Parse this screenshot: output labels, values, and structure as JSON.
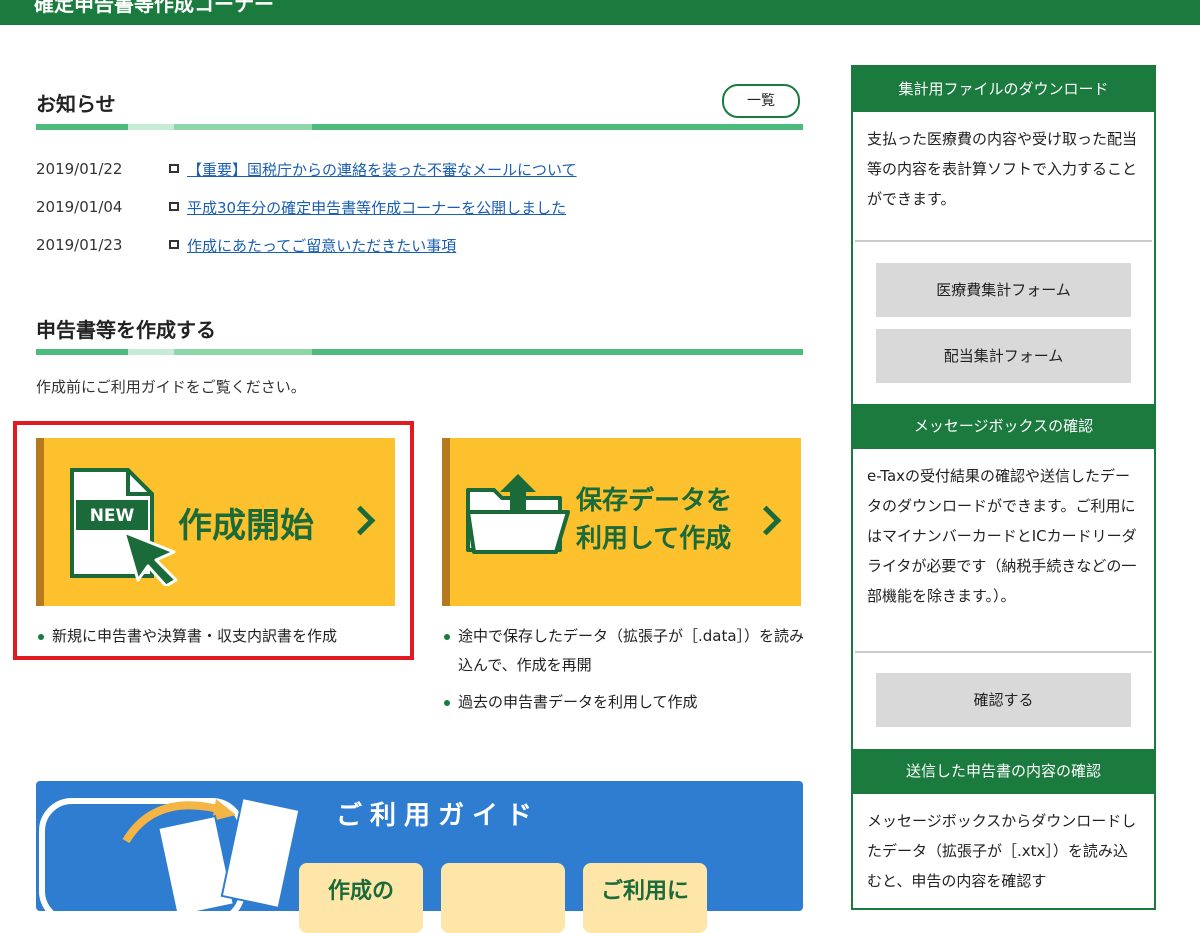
{
  "header": {
    "title": "確定申告書等作成コーナー"
  },
  "news": {
    "title": "お知らせ",
    "list_button": "一覧",
    "items": [
      {
        "date": "2019/01/22",
        "text": "【重要】国税庁からの連絡を装った不審なメールについて"
      },
      {
        "date": "2019/01/04",
        "text": "平成30年分の確定申告書等作成コーナーを公開しました"
      },
      {
        "date": "2019/01/23",
        "text": "作成にあたってご留意いただきたい事項"
      }
    ]
  },
  "create": {
    "title": "申告書等を作成する",
    "intro": "作成前にご利用ガイドをご覧ください。",
    "start_card": {
      "badge": "NEW",
      "label": "作成開始",
      "bullets": [
        "新規に申告書や決算書・収支内訳書を作成"
      ]
    },
    "saved_card": {
      "label_line1": "保存データを",
      "label_line2": "利用して作成",
      "bullets": [
        "途中で保存したデータ（拡張子が［.data］）を読み込んで、作成を再開",
        "過去の申告書データを利用して作成"
      ]
    }
  },
  "guide": {
    "title": "ご利用ガイド",
    "buttons": [
      "作成の",
      "",
      "ご利用に"
    ]
  },
  "sidebar": {
    "sections": [
      {
        "header": "集計用ファイルのダウンロード",
        "text": "支払った医療費の内容や受け取った配当等の内容を表計算ソフトで入力することができます。",
        "buttons": [
          "医療費集計フォーム",
          "配当集計フォーム"
        ]
      },
      {
        "header": "メッセージボックスの確認",
        "text": "e-Taxの受付結果の確認や送信したデータのダウンロードができます。ご利用にはマイナンバーカードとICカードリーダライタが必要です（納税手続きなどの一部機能を除きます。）。",
        "buttons": [
          "確認する"
        ]
      },
      {
        "header": "送信した申告書の内容の確認",
        "text": "メッセージボックスからダウンロードしたデータ（拡張子が［.xtx］）を読み込むと、申告の内容を確認す",
        "buttons": []
      }
    ]
  },
  "colors": {
    "brand_green": "#1b7b3e",
    "card_yellow": "#fcc12c",
    "guide_blue": "#2f7dd1",
    "highlight_red": "#e11b22"
  }
}
